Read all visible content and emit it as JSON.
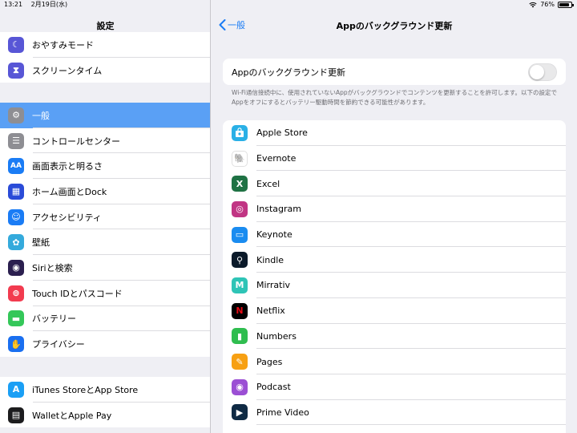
{
  "status_bar": {
    "time": "13:21",
    "date": "2月19日(水)",
    "battery": "76%"
  },
  "sidebar": {
    "title": "設定",
    "groups": [
      [
        {
          "label": "おやすみモード",
          "icon": "moon-icon",
          "color": "#5856d6",
          "glyph": "☾"
        },
        {
          "label": "スクリーンタイム",
          "icon": "hourglass-icon",
          "color": "#5856d6",
          "glyph": "⧗"
        }
      ],
      [
        {
          "label": "一般",
          "icon": "gear-icon",
          "color": "#8e8e93",
          "glyph": "⚙",
          "selected": true
        },
        {
          "label": "コントロールセンター",
          "icon": "switches-icon",
          "color": "#8e8e93",
          "glyph": "☰"
        },
        {
          "label": "画面表示と明るさ",
          "icon": "text-size-icon",
          "color": "#1a7cf5",
          "glyph": "AA"
        },
        {
          "label": "ホーム画面とDock",
          "icon": "home-grid-icon",
          "color": "#2a4bd8",
          "glyph": "▦"
        },
        {
          "label": "アクセシビリティ",
          "icon": "accessibility-icon",
          "color": "#1a7cf5",
          "glyph": "☺"
        },
        {
          "label": "壁紙",
          "icon": "wallpaper-flower-icon",
          "color": "#34aadc",
          "glyph": "✿"
        },
        {
          "label": "Siriと検索",
          "icon": "siri-icon",
          "color": "#2b1f4f",
          "glyph": "◉"
        },
        {
          "label": "Touch IDとパスコード",
          "icon": "fingerprint-icon",
          "color": "#f23b4f",
          "glyph": "⊚"
        },
        {
          "label": "バッテリー",
          "icon": "battery-icon",
          "color": "#34c759",
          "glyph": "▬"
        },
        {
          "label": "プライバシー",
          "icon": "hand-icon",
          "color": "#1a6ff0",
          "glyph": "✋"
        }
      ],
      [
        {
          "label": "iTunes StoreとApp Store",
          "icon": "app-store-icon",
          "color": "#1a9ff5",
          "glyph": "A"
        },
        {
          "label": "WalletとApple Pay",
          "icon": "wallet-icon",
          "color": "#1c1c1e",
          "glyph": "▤"
        }
      ]
    ]
  },
  "detail": {
    "back_label": "一般",
    "title": "Appのバックグラウンド更新",
    "toggle_label": "Appのバックグラウンド更新",
    "toggle_on": false,
    "description": "Wi-Fi通信接続中に、使用されていないAppがバックグラウンドでコンテンツを更新することを許可します。以下の設定でAppをオフにするとバッテリー駆動時間を節約できる可能性があります。",
    "apps": [
      {
        "label": "Apple Store",
        "icon": "apple-store-bag-icon",
        "color": "#2ab0e6",
        "glyph": ""
      },
      {
        "label": "Evernote",
        "icon": "evernote-elephant-icon",
        "color": "#ffffff",
        "glyph": "🐘",
        "fg": "#2dbe60"
      },
      {
        "label": "Excel",
        "icon": "excel-icon",
        "color": "#1f7244",
        "glyph": "X"
      },
      {
        "label": "Instagram",
        "icon": "instagram-icon",
        "color": "#c13584",
        "glyph": "◎"
      },
      {
        "label": "Keynote",
        "icon": "keynote-icon",
        "color": "#1a8cf0",
        "glyph": "▭"
      },
      {
        "label": "Kindle",
        "icon": "kindle-reader-icon",
        "color": "#0b1a2a",
        "glyph": "⚲"
      },
      {
        "label": "Mirrativ",
        "icon": "mirrativ-icon",
        "color": "#2ec4b6",
        "glyph": "M"
      },
      {
        "label": "Netflix",
        "icon": "netflix-icon",
        "color": "#000000",
        "glyph": "N",
        "fg": "#e50914"
      },
      {
        "label": "Numbers",
        "icon": "numbers-chart-icon",
        "color": "#2fbd4f",
        "glyph": "▮"
      },
      {
        "label": "Pages",
        "icon": "pages-pen-icon",
        "color": "#f7a013",
        "glyph": "✎"
      },
      {
        "label": "Podcast",
        "icon": "podcast-icon",
        "color": "#9b4fd4",
        "glyph": "◉"
      },
      {
        "label": "Prime Video",
        "icon": "prime-video-icon",
        "color": "#0f2a44",
        "glyph": "▶"
      }
    ]
  }
}
